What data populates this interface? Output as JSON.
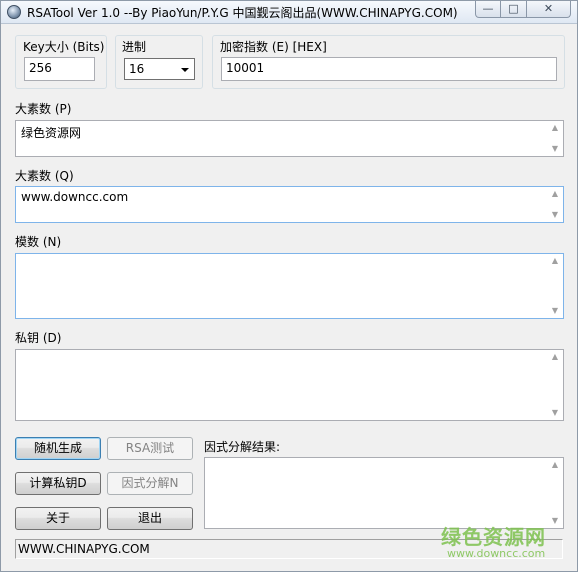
{
  "window": {
    "title": "RSATool Ver 1.0 --By PiaoYun/P.Y.G 中国觐云阁出品(WWW.CHINAPYG.COM)"
  },
  "titlebar_buttons": {
    "minimize": "—",
    "maximize": "□",
    "close": "✕"
  },
  "keysize": {
    "label": "Key大小 (Bits)",
    "value": "256"
  },
  "radix": {
    "label": "进制",
    "selected": "16"
  },
  "exponent": {
    "label": "加密指数 (E) [HEX]",
    "value": "10001"
  },
  "prime_p": {
    "label": "大素数 (P)",
    "value": "绿色资源网"
  },
  "prime_q": {
    "label": "大素数 (Q)",
    "value": "www.downcc.com"
  },
  "modulus": {
    "label": "模数 (N)",
    "value": ""
  },
  "private_key": {
    "label": "私钥 (D)",
    "value": ""
  },
  "factor_result": {
    "label": "因式分解结果:",
    "value": ""
  },
  "buttons": {
    "random_generate": "随机生成",
    "rsa_test": "RSA测试",
    "compute_private": "计算私钥D",
    "factorize": "因式分解N",
    "about": "关于",
    "exit": "退出"
  },
  "status_text": "WWW.CHINAPYG.COM",
  "watermark": {
    "cn": "绿色资源网",
    "en": "www.downcc.com",
    "color": "#7ec24f"
  },
  "scroll_icons": {
    "up": "▲",
    "down": "▼"
  }
}
